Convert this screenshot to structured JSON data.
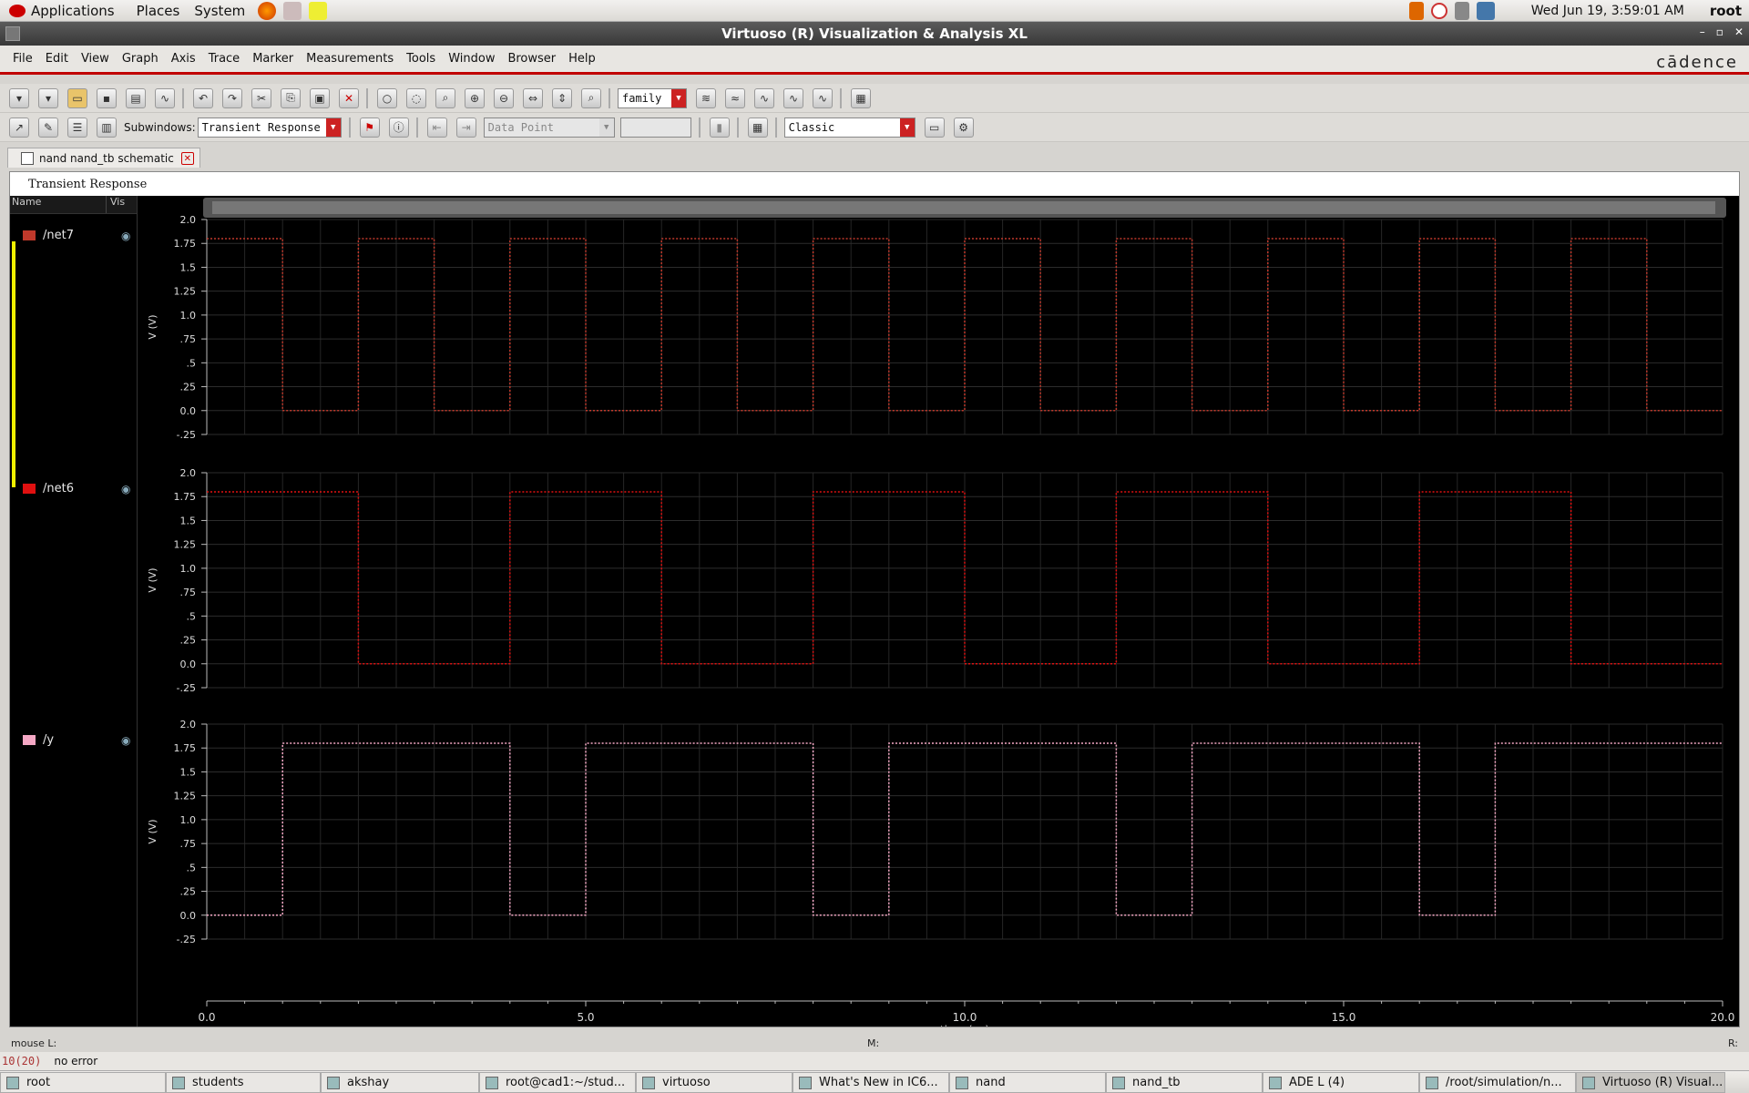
{
  "top_panel": {
    "menus": [
      "Applications",
      "Places",
      "System"
    ],
    "clock": "Wed Jun 19,  3:59:01 AM",
    "user": "root"
  },
  "window": {
    "title": "Virtuoso (R) Visualization & Analysis XL",
    "buttons": [
      "–",
      "▫",
      "✕"
    ]
  },
  "menubar": {
    "items": [
      "File",
      "Edit",
      "View",
      "Graph",
      "Axis",
      "Trace",
      "Marker",
      "Measurements",
      "Tools",
      "Window",
      "Browser",
      "Help"
    ],
    "brand": "cādence"
  },
  "toolbar1": {
    "family_select": "family"
  },
  "toolbar2": {
    "subwindows_label": "Subwindows:",
    "subwindows_value": "Transient Response",
    "datapoint_value": "Data Point",
    "style_value": "Classic"
  },
  "tab": {
    "label": "nand nand_tb schematic"
  },
  "plot": {
    "subwindow_title": "Transient Response",
    "legend_header_name": "Name",
    "legend_header_vis": "Vis"
  },
  "chart_data": {
    "type": "line",
    "xlabel": "time (us)",
    "xlim": [
      0.0,
      20.0
    ],
    "x_ticks": [
      "0.0",
      "5.0",
      "10.0",
      "15.0",
      "20.0"
    ],
    "y_ticks": [
      "2.0",
      "1.75",
      "1.5",
      "1.25",
      "1.0",
      ".75",
      ".5",
      ".25",
      "0.0",
      "-.25"
    ],
    "panels": [
      {
        "name": "/net7",
        "color": "#c0392b",
        "ylabel": "V (V)",
        "ylim": [
          -0.25,
          2.0
        ],
        "x": [
          0,
          1,
          1,
          2,
          2,
          3,
          3,
          4,
          4,
          5,
          5,
          6,
          6,
          7,
          7,
          8,
          8,
          9,
          9,
          10,
          10,
          11,
          11,
          12,
          12,
          13,
          13,
          14,
          14,
          15,
          15,
          16,
          16,
          17,
          17,
          18,
          18,
          19,
          19,
          20
        ],
        "y": [
          1.8,
          1.8,
          0,
          0,
          1.8,
          1.8,
          0,
          0,
          1.8,
          1.8,
          0,
          0,
          1.8,
          1.8,
          0,
          0,
          1.8,
          1.8,
          0,
          0,
          1.8,
          1.8,
          0,
          0,
          1.8,
          1.8,
          0,
          0,
          1.8,
          1.8,
          0,
          0,
          1.8,
          1.8,
          0,
          0,
          1.8,
          1.8,
          0,
          0
        ]
      },
      {
        "name": "/net6",
        "color": "#e01010",
        "ylabel": "V (V)",
        "ylim": [
          -0.25,
          2.0
        ],
        "x": [
          0,
          2,
          2,
          4,
          4,
          6,
          6,
          8,
          8,
          10,
          10,
          12,
          12,
          14,
          14,
          16,
          16,
          18,
          18,
          20
        ],
        "y": [
          1.8,
          1.8,
          0,
          0,
          1.8,
          1.8,
          0,
          0,
          1.8,
          1.8,
          0,
          0,
          1.8,
          1.8,
          0,
          0,
          1.8,
          1.8,
          0,
          0
        ]
      },
      {
        "name": "/y",
        "color": "#f4a7c4",
        "ylabel": "V (V)",
        "ylim": [
          -0.25,
          2.0
        ],
        "x": [
          0,
          1,
          1,
          4,
          4,
          5,
          5,
          8,
          8,
          9,
          9,
          12,
          12,
          13,
          13,
          16,
          16,
          17,
          17,
          20
        ],
        "y": [
          0,
          0,
          1.8,
          1.8,
          0,
          0,
          1.8,
          1.8,
          0,
          0,
          1.8,
          1.8,
          0,
          0,
          1.8,
          1.8,
          0,
          0,
          1.8,
          1.8
        ]
      }
    ]
  },
  "status": {
    "mouse_l": "mouse L:",
    "mouse_m": "M:",
    "mouse_r": "R:",
    "cmd_count": "10(20)",
    "message": "no error"
  },
  "taskbar": {
    "items": [
      "root",
      "students",
      "akshay",
      "root@cad1:~/stud...",
      "virtuoso",
      "What's New in IC6...",
      "nand",
      "nand_tb",
      "ADE L (4)",
      "/root/simulation/n...",
      "Virtuoso (R) Visual..."
    ]
  }
}
